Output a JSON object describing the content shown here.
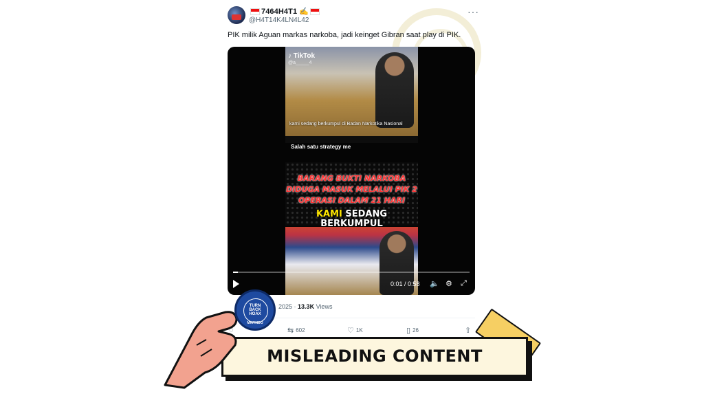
{
  "tweet": {
    "display_name": "7464H4T1",
    "handle": "@H4T14K4LN4L42",
    "text": "PIK milik Aguan markas narkoba, jadi keinget Gibran saat play di PIK.",
    "more_icon": "more-horizontal-icon"
  },
  "video": {
    "brand": "TikTok",
    "tiktok_handle": "@a_____4",
    "caption_1": "kami sedang berkumpul di Badan Narkotika Nasional",
    "caption_2": "Salah  satu strategy me",
    "headline_1": "BARANG BUKTI NARKOBA",
    "headline_2": "DIDUGA MASUK MELALUI PIK 2",
    "headline_3": "OPERASI DALAM 21 HARI",
    "kami": "KAMI",
    "sedang": "SEDANG",
    "berkumpul": "BERKUMPUL",
    "time": "0:01 / 0:58",
    "progress": 0.02
  },
  "meta": {
    "year": "2025 ·",
    "views_count": "13.3K",
    "views_label": "Views"
  },
  "actions": {
    "reply_icon": "reply-icon",
    "retweets": "602",
    "likes": "1K",
    "bookmarks": "26"
  },
  "overlay": {
    "label": "MISLEADING CONTENT",
    "badge_title": "TURN BACK HOAX",
    "badge_text_top": "TURN",
    "badge_text_mid": "BACK",
    "badge_text_bottom": "HOAX",
    "badge_footer": "MAFINDO"
  }
}
